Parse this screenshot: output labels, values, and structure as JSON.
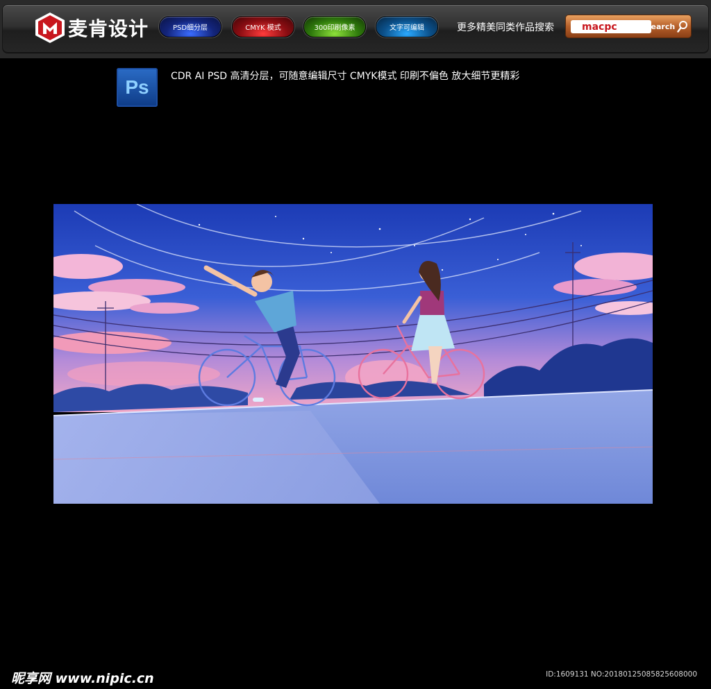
{
  "header": {
    "logo_text": "麦肯设计",
    "pills": {
      "psd": "PSD细分层",
      "cmyk": "CMYK 模式",
      "dpi": "300印刷像素",
      "text": "文字可编辑"
    },
    "more_label": "更多精美同类作品搜索",
    "search": {
      "value": "macpc",
      "button_label": "search"
    }
  },
  "format_line": {
    "icon_text": "Ps",
    "features": "CDR  AI   PSD 高清分层，可随意编辑尺寸  CMYK模式  印刷不偏色  放大细节更精彩"
  },
  "footer": {
    "watermark": "昵享网 www.nipic.cn",
    "id_line": "ID:1609131 NO:20180125085825608000"
  },
  "colors": {
    "brand_red": "#c8161d",
    "sky_top": "#1f3fb8",
    "sky_bottom": "#e79bc0",
    "wall": "#7a94d8"
  }
}
